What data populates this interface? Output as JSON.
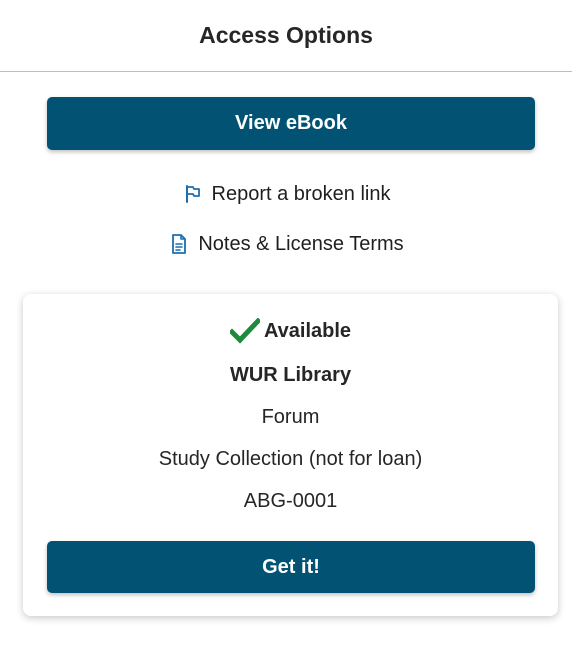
{
  "header": {
    "title": "Access Options"
  },
  "view_button": {
    "label": "View eBook"
  },
  "links": {
    "report": "Report a broken link",
    "notes": "Notes & License Terms"
  },
  "holding": {
    "status": "Available",
    "library": "WUR Library",
    "location": "Forum",
    "collection": "Study Collection (not for loan)",
    "call_number": "ABG-0001",
    "get_label": "Get it!"
  },
  "colors": {
    "primary": "#025373",
    "link_icon": "#1a6fb3",
    "available": "#1e8a3c"
  },
  "icons": {
    "report": "flag-icon",
    "notes": "document-icon",
    "status": "check-icon"
  }
}
